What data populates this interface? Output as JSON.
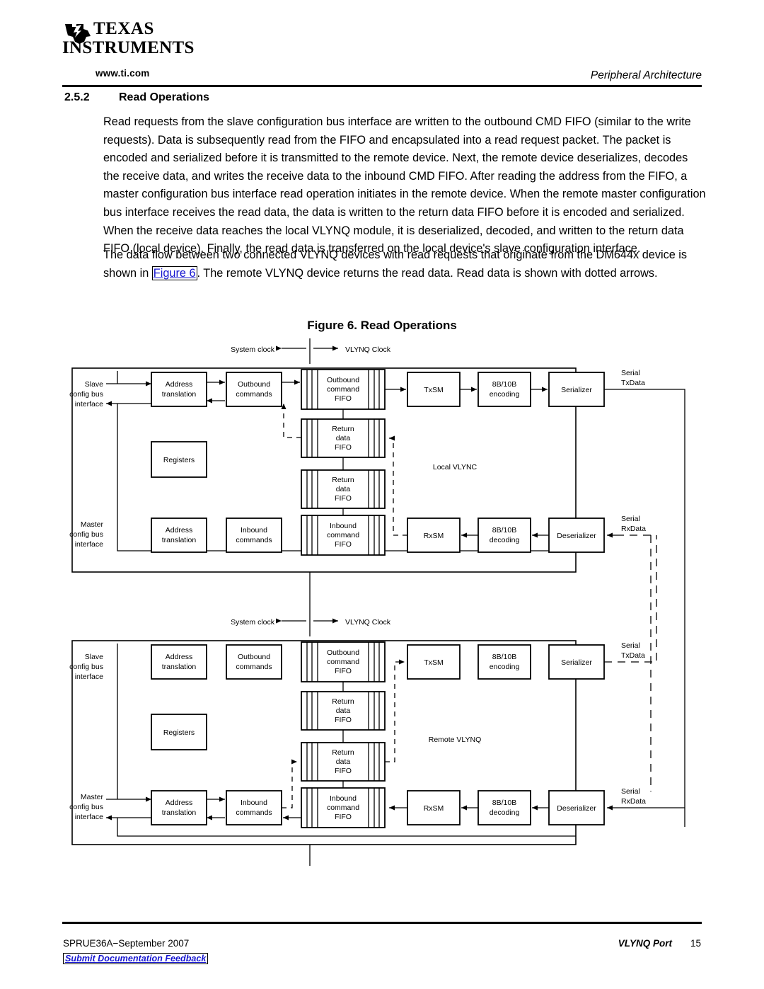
{
  "header": {
    "logo_line1": "TEXAS",
    "logo_line2": "INSTRUMENTS",
    "url": "www.ti.com",
    "running_head": "Peripheral Architecture"
  },
  "section": {
    "number": "2.5.2",
    "title": "Read Operations",
    "paragraph1": "Read requests from the slave configuration bus interface are written to the outbound CMD FIFO (similar to the write requests). Data is subsequently read from the FIFO and encapsulated into a read request packet. The packet is encoded and serialized before it is transmitted to the remote device. Next, the remote device deserializes, decodes the receive data, and writes the receive data to the inbound CMD FIFO. After reading the address from the FIFO, a master configuration bus interface read operation initiates in the remote device. When the remote master configuration bus interface receives the read data, the data is written to the return data FIFO before it is encoded and serialized. When the receive data reaches the local VLYNQ module, it is deserialized, decoded, and written to the return data FIFO (local device). Finally, the read data is transferred on the local device's slave configuration interface.",
    "paragraph2_before": "The data flow between two connected VLYNQ devices with read requests that originate from the DM644x device is shown in ",
    "paragraph2_link": "Figure 6",
    "paragraph2_after": ". The remote VLYNQ device returns the read data. Read data is shown with dotted arrows."
  },
  "figure": {
    "caption": "Figure 6. Read Operations",
    "clock_left": "System clock",
    "clock_right": "VLYNQ Clock",
    "groups": [
      {
        "name": "Local VLYNC",
        "slave_label": [
          "Slave",
          "config bus",
          "interface"
        ],
        "master_label": [
          "Master",
          "config bus",
          "interface"
        ],
        "serial_tx": [
          "Serial",
          "TxData"
        ],
        "serial_rx": [
          "Serial",
          "RxData"
        ],
        "blocks": {
          "addr_top": [
            "Address",
            "translation"
          ],
          "outbound_cmds": [
            "Outbound",
            "commands"
          ],
          "outbound_fifo": [
            "Outbound",
            "command",
            "FIFO"
          ],
          "txsm": [
            "TxSM"
          ],
          "enc": [
            "8B/10B",
            "encoding"
          ],
          "ser": [
            "Serializer"
          ],
          "return_fifo_1": [
            "Return",
            "data",
            "FIFO"
          ],
          "return_fifo_2": [
            "Return",
            "data",
            "FIFO"
          ],
          "registers": [
            "Registers"
          ],
          "addr_bot": [
            "Address",
            "translation"
          ],
          "inbound_cmds": [
            "Inbound",
            "commands"
          ],
          "inbound_fifo": [
            "Inbound",
            "command",
            "FIFO"
          ],
          "rxsm": [
            "RxSM"
          ],
          "dec": [
            "8B/10B",
            "decoding"
          ],
          "deser": [
            "Deserializer"
          ]
        }
      },
      {
        "name": "Remote VLYNQ",
        "slave_label": [
          "Slave",
          "config bus",
          "interface"
        ],
        "master_label": [
          "Master",
          "config bus",
          "interface"
        ],
        "serial_tx": [
          "Serial",
          "TxData"
        ],
        "serial_rx": [
          "Serial",
          "RxData"
        ],
        "blocks": {
          "addr_top": [
            "Address",
            "translation"
          ],
          "outbound_cmds": [
            "Outbound",
            "commands"
          ],
          "outbound_fifo": [
            "Outbound",
            "command",
            "FIFO"
          ],
          "txsm": [
            "TxSM"
          ],
          "enc": [
            "8B/10B",
            "encoding"
          ],
          "ser": [
            "Serializer"
          ],
          "return_fifo_1": [
            "Return",
            "data",
            "FIFO"
          ],
          "return_fifo_2": [
            "Return",
            "data",
            "FIFO"
          ],
          "registers": [
            "Registers"
          ],
          "addr_bot": [
            "Address",
            "translation"
          ],
          "inbound_cmds": [
            "Inbound",
            "commands"
          ],
          "inbound_fifo": [
            "Inbound",
            "command",
            "FIFO"
          ],
          "rxsm": [
            "RxSM"
          ],
          "dec": [
            "8B/10B",
            "decoding"
          ],
          "deser": [
            "Deserializer"
          ]
        }
      }
    ]
  },
  "footer": {
    "left": "SPRUE36A−September 2007",
    "right": "VLYNQ Port",
    "page": "15",
    "feedback": "Submit Documentation Feedback"
  },
  "colors": {
    "link": "#1515d0",
    "rule": "#000000",
    "text": "#000000"
  }
}
